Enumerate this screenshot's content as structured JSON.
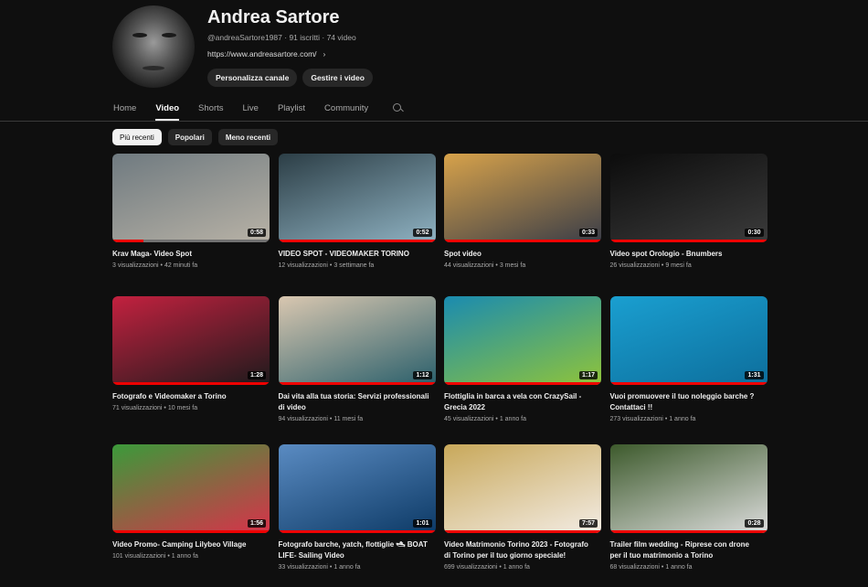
{
  "channel": {
    "name": "Andrea Sartore",
    "handle": "@andreaSartore1987",
    "subscribers": "91 iscritti",
    "videos_count": "74 video",
    "link": "https://www.andreasartore.com/",
    "buttons": [
      "Personalizza canale",
      "Gestire i video"
    ]
  },
  "tabs": [
    "Home",
    "Video",
    "Shorts",
    "Live",
    "Playlist",
    "Community"
  ],
  "active_tab": "Video",
  "chips": [
    "Più recenti",
    "Popolari",
    "Meno recenti"
  ],
  "videos": [
    {
      "title": "Krav Maga- Video Spot",
      "views": "3 visualizzazioni",
      "age": "42 minuti fa",
      "duration": "0:58",
      "progress": 0.2,
      "colors": [
        "#6f7a80",
        "#b8b2a6"
      ]
    },
    {
      "title": "VIDEO SPOT - VIDEOMAKER TORINO",
      "views": "12 visualizzazioni",
      "age": "3 settimane fa",
      "duration": "0:52",
      "progress": 1,
      "colors": [
        "#2c3e46",
        "#8fb2c2"
      ]
    },
    {
      "title": "Spot video",
      "views": "44 visualizzazioni",
      "age": "3 mesi fa",
      "duration": "0:33",
      "progress": 1,
      "colors": [
        "#d7a24a",
        "#3a3d48"
      ]
    },
    {
      "title": "Video spot Orologio - Bnumbers",
      "views": "26 visualizzazioni",
      "age": "9 mesi fa",
      "duration": "0:30",
      "progress": 1,
      "colors": [
        "#0c0c0c",
        "#3b3b3b"
      ]
    },
    {
      "title": "Fotografo e Videomaker a Torino",
      "views": "71 visualizzazioni",
      "age": "10 mesi fa",
      "duration": "1:28",
      "progress": 1,
      "colors": [
        "#c3213f",
        "#1e1a1c"
      ]
    },
    {
      "title": "Dai vita alla tua storia: Servizi professionali di video",
      "views": "94 visualizzazioni",
      "age": "11 mesi fa",
      "duration": "1:12",
      "progress": 1,
      "colors": [
        "#d9c7b0",
        "#2a5f6b"
      ]
    },
    {
      "title": "Flottiglia in barca a vela con CrazySail - Grecia 2022",
      "views": "45 visualizzazioni",
      "age": "1 anno fa",
      "duration": "1:17",
      "progress": 1,
      "colors": [
        "#1a8bb0",
        "#8fc43a"
      ]
    },
    {
      "title": "Vuoi promuovere il tuo noleggio barche ? Contattaci !!",
      "views": "273 visualizzazioni",
      "age": "1 anno fa",
      "duration": "1:31",
      "progress": 1,
      "colors": [
        "#1a9fd0",
        "#0d6e9c"
      ]
    },
    {
      "title": "Video Promo- Camping Lilybeo Village",
      "views": "101 visualizzazioni",
      "age": "1 anno fa",
      "duration": "1:56",
      "progress": 1,
      "colors": [
        "#3b9a3a",
        "#d8324a"
      ]
    },
    {
      "title": "Fotografo barche, yatch, flottiglie 🛥 BOAT LIFE- Sailing Video",
      "views": "33 visualizzazioni",
      "age": "1 anno fa",
      "duration": "1:01",
      "progress": 1,
      "colors": [
        "#5a8bc2",
        "#0d3a66"
      ]
    },
    {
      "title": "Video Matrimonio Torino 2023 - Fotografo di Torino per il tuo giorno speciale!",
      "views": "699 visualizzazioni",
      "age": "1 anno fa",
      "duration": "7:57",
      "progress": 1,
      "colors": [
        "#c8a85a",
        "#f3ece4"
      ]
    },
    {
      "title": "Trailer film wedding - Riprese con drone per il tuo matrimonio a Torino",
      "views": "68 visualizzazioni",
      "age": "1 anno fa",
      "duration": "0:28",
      "progress": 1,
      "colors": [
        "#3d5a2c",
        "#dcdcdc"
      ]
    }
  ]
}
